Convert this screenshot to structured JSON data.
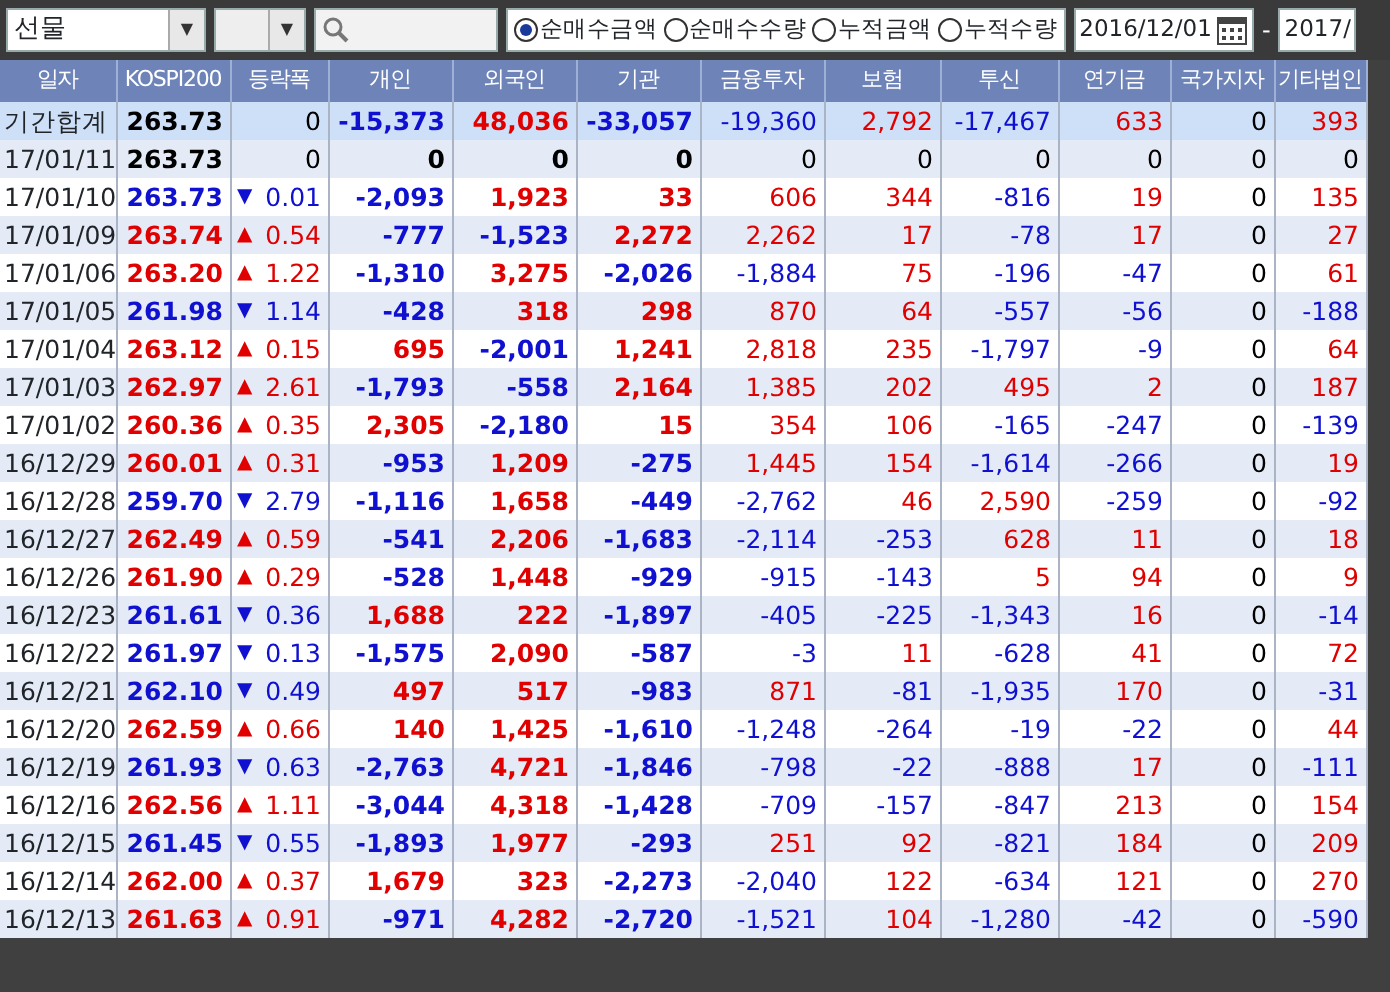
{
  "toolbar": {
    "market_select": {
      "value": "선물",
      "caret": "▼"
    },
    "sub_select": {
      "caret": "▼"
    },
    "view_options": [
      {
        "label": "순매수금액",
        "selected": true
      },
      {
        "label": "순매수수량",
        "selected": false
      },
      {
        "label": "누적금액",
        "selected": false
      },
      {
        "label": "누적수량",
        "selected": false
      }
    ],
    "start_date": "2016/12/01",
    "range_separator": "-",
    "end_date": "2017/"
  },
  "table": {
    "columns": [
      "일자",
      "KOSPI200",
      "등락폭",
      "개인",
      "외국인",
      "기관",
      "금융투자",
      "보험",
      "투신",
      "연기금",
      "국가지자",
      "기타법인"
    ],
    "rows": [
      {
        "kind": "total",
        "date": "기간합계",
        "kospi200": {
          "text": "263.73",
          "color": "#000000"
        },
        "change": {
          "text": "0",
          "color": "#000000"
        },
        "values": [
          {
            "text": "-15,373",
            "color": "#1010d0"
          },
          {
            "text": "48,036",
            "color": "#e00000"
          },
          {
            "text": "-33,057",
            "color": "#1010d0"
          },
          {
            "text": "-19,360",
            "color": "#1010d0"
          },
          {
            "text": "2,792",
            "color": "#e00000"
          },
          {
            "text": "-17,467",
            "color": "#1010d0"
          },
          {
            "text": "633",
            "color": "#e00000"
          },
          {
            "text": "0",
            "color": "#000000"
          },
          {
            "text": "393",
            "color": "#e00000"
          }
        ]
      },
      {
        "kind": "day",
        "date": "17/01/11",
        "kospi200": {
          "text": "263.73",
          "color": "#000000"
        },
        "change": {
          "text": "0",
          "color": "#000000"
        },
        "values": [
          {
            "text": "0",
            "color": "#000000"
          },
          {
            "text": "0",
            "color": "#000000"
          },
          {
            "text": "0",
            "color": "#000000"
          },
          {
            "text": "0",
            "color": "#000000"
          },
          {
            "text": "0",
            "color": "#000000"
          },
          {
            "text": "0",
            "color": "#000000"
          },
          {
            "text": "0",
            "color": "#000000"
          },
          {
            "text": "0",
            "color": "#000000"
          },
          {
            "text": "0",
            "color": "#000000"
          }
        ]
      },
      {
        "kind": "day",
        "date": "17/01/10",
        "kospi200": {
          "text": "263.73",
          "color": "#1010d0"
        },
        "change": {
          "arrow": "▼",
          "text": "0.01",
          "color": "#1010d0"
        },
        "values": [
          {
            "text": "-2,093",
            "color": "#1010d0"
          },
          {
            "text": "1,923",
            "color": "#e00000"
          },
          {
            "text": "33",
            "color": "#e00000"
          },
          {
            "text": "606",
            "color": "#e00000"
          },
          {
            "text": "344",
            "color": "#e00000"
          },
          {
            "text": "-816",
            "color": "#1010d0"
          },
          {
            "text": "19",
            "color": "#e00000"
          },
          {
            "text": "0",
            "color": "#000000"
          },
          {
            "text": "135",
            "color": "#e00000"
          }
        ]
      },
      {
        "kind": "day",
        "date": "17/01/09",
        "kospi200": {
          "text": "263.74",
          "color": "#e00000"
        },
        "change": {
          "arrow": "▲",
          "text": "0.54",
          "color": "#e00000"
        },
        "values": [
          {
            "text": "-777",
            "color": "#1010d0"
          },
          {
            "text": "-1,523",
            "color": "#1010d0"
          },
          {
            "text": "2,272",
            "color": "#e00000"
          },
          {
            "text": "2,262",
            "color": "#e00000"
          },
          {
            "text": "17",
            "color": "#e00000"
          },
          {
            "text": "-78",
            "color": "#1010d0"
          },
          {
            "text": "17",
            "color": "#e00000"
          },
          {
            "text": "0",
            "color": "#000000"
          },
          {
            "text": "27",
            "color": "#e00000"
          }
        ]
      },
      {
        "kind": "day",
        "date": "17/01/06",
        "kospi200": {
          "text": "263.20",
          "color": "#e00000"
        },
        "change": {
          "arrow": "▲",
          "text": "1.22",
          "color": "#e00000"
        },
        "values": [
          {
            "text": "-1,310",
            "color": "#1010d0"
          },
          {
            "text": "3,275",
            "color": "#e00000"
          },
          {
            "text": "-2,026",
            "color": "#1010d0"
          },
          {
            "text": "-1,884",
            "color": "#1010d0"
          },
          {
            "text": "75",
            "color": "#e00000"
          },
          {
            "text": "-196",
            "color": "#1010d0"
          },
          {
            "text": "-47",
            "color": "#1010d0"
          },
          {
            "text": "0",
            "color": "#000000"
          },
          {
            "text": "61",
            "color": "#e00000"
          }
        ]
      },
      {
        "kind": "day",
        "date": "17/01/05",
        "kospi200": {
          "text": "261.98",
          "color": "#1010d0"
        },
        "change": {
          "arrow": "▼",
          "text": "1.14",
          "color": "#1010d0"
        },
        "values": [
          {
            "text": "-428",
            "color": "#1010d0"
          },
          {
            "text": "318",
            "color": "#e00000"
          },
          {
            "text": "298",
            "color": "#e00000"
          },
          {
            "text": "870",
            "color": "#e00000"
          },
          {
            "text": "64",
            "color": "#e00000"
          },
          {
            "text": "-557",
            "color": "#1010d0"
          },
          {
            "text": "-56",
            "color": "#1010d0"
          },
          {
            "text": "0",
            "color": "#000000"
          },
          {
            "text": "-188",
            "color": "#1010d0"
          }
        ]
      },
      {
        "kind": "day",
        "date": "17/01/04",
        "kospi200": {
          "text": "263.12",
          "color": "#e00000"
        },
        "change": {
          "arrow": "▲",
          "text": "0.15",
          "color": "#e00000"
        },
        "values": [
          {
            "text": "695",
            "color": "#e00000"
          },
          {
            "text": "-2,001",
            "color": "#1010d0"
          },
          {
            "text": "1,241",
            "color": "#e00000"
          },
          {
            "text": "2,818",
            "color": "#e00000"
          },
          {
            "text": "235",
            "color": "#e00000"
          },
          {
            "text": "-1,797",
            "color": "#1010d0"
          },
          {
            "text": "-9",
            "color": "#1010d0"
          },
          {
            "text": "0",
            "color": "#000000"
          },
          {
            "text": "64",
            "color": "#e00000"
          }
        ]
      },
      {
        "kind": "day",
        "date": "17/01/03",
        "kospi200": {
          "text": "262.97",
          "color": "#e00000"
        },
        "change": {
          "arrow": "▲",
          "text": "2.61",
          "color": "#e00000"
        },
        "values": [
          {
            "text": "-1,793",
            "color": "#1010d0"
          },
          {
            "text": "-558",
            "color": "#1010d0"
          },
          {
            "text": "2,164",
            "color": "#e00000"
          },
          {
            "text": "1,385",
            "color": "#e00000"
          },
          {
            "text": "202",
            "color": "#e00000"
          },
          {
            "text": "495",
            "color": "#e00000"
          },
          {
            "text": "2",
            "color": "#e00000"
          },
          {
            "text": "0",
            "color": "#000000"
          },
          {
            "text": "187",
            "color": "#e00000"
          }
        ]
      },
      {
        "kind": "day",
        "date": "17/01/02",
        "kospi200": {
          "text": "260.36",
          "color": "#e00000"
        },
        "change": {
          "arrow": "▲",
          "text": "0.35",
          "color": "#e00000"
        },
        "values": [
          {
            "text": "2,305",
            "color": "#e00000"
          },
          {
            "text": "-2,180",
            "color": "#1010d0"
          },
          {
            "text": "15",
            "color": "#e00000"
          },
          {
            "text": "354",
            "color": "#e00000"
          },
          {
            "text": "106",
            "color": "#e00000"
          },
          {
            "text": "-165",
            "color": "#1010d0"
          },
          {
            "text": "-247",
            "color": "#1010d0"
          },
          {
            "text": "0",
            "color": "#000000"
          },
          {
            "text": "-139",
            "color": "#1010d0"
          }
        ]
      },
      {
        "kind": "day",
        "date": "16/12/29",
        "kospi200": {
          "text": "260.01",
          "color": "#e00000"
        },
        "change": {
          "arrow": "▲",
          "text": "0.31",
          "color": "#e00000"
        },
        "values": [
          {
            "text": "-953",
            "color": "#1010d0"
          },
          {
            "text": "1,209",
            "color": "#e00000"
          },
          {
            "text": "-275",
            "color": "#1010d0"
          },
          {
            "text": "1,445",
            "color": "#e00000"
          },
          {
            "text": "154",
            "color": "#e00000"
          },
          {
            "text": "-1,614",
            "color": "#1010d0"
          },
          {
            "text": "-266",
            "color": "#1010d0"
          },
          {
            "text": "0",
            "color": "#000000"
          },
          {
            "text": "19",
            "color": "#e00000"
          }
        ]
      },
      {
        "kind": "day",
        "date": "16/12/28",
        "kospi200": {
          "text": "259.70",
          "color": "#1010d0"
        },
        "change": {
          "arrow": "▼",
          "text": "2.79",
          "color": "#1010d0"
        },
        "values": [
          {
            "text": "-1,116",
            "color": "#1010d0"
          },
          {
            "text": "1,658",
            "color": "#e00000"
          },
          {
            "text": "-449",
            "color": "#1010d0"
          },
          {
            "text": "-2,762",
            "color": "#1010d0"
          },
          {
            "text": "46",
            "color": "#e00000"
          },
          {
            "text": "2,590",
            "color": "#e00000"
          },
          {
            "text": "-259",
            "color": "#1010d0"
          },
          {
            "text": "0",
            "color": "#000000"
          },
          {
            "text": "-92",
            "color": "#1010d0"
          }
        ]
      },
      {
        "kind": "day",
        "date": "16/12/27",
        "kospi200": {
          "text": "262.49",
          "color": "#e00000"
        },
        "change": {
          "arrow": "▲",
          "text": "0.59",
          "color": "#e00000"
        },
        "values": [
          {
            "text": "-541",
            "color": "#1010d0"
          },
          {
            "text": "2,206",
            "color": "#e00000"
          },
          {
            "text": "-1,683",
            "color": "#1010d0"
          },
          {
            "text": "-2,114",
            "color": "#1010d0"
          },
          {
            "text": "-253",
            "color": "#1010d0"
          },
          {
            "text": "628",
            "color": "#e00000"
          },
          {
            "text": "11",
            "color": "#e00000"
          },
          {
            "text": "0",
            "color": "#000000"
          },
          {
            "text": "18",
            "color": "#e00000"
          }
        ]
      },
      {
        "kind": "day",
        "date": "16/12/26",
        "kospi200": {
          "text": "261.90",
          "color": "#e00000"
        },
        "change": {
          "arrow": "▲",
          "text": "0.29",
          "color": "#e00000"
        },
        "values": [
          {
            "text": "-528",
            "color": "#1010d0"
          },
          {
            "text": "1,448",
            "color": "#e00000"
          },
          {
            "text": "-929",
            "color": "#1010d0"
          },
          {
            "text": "-915",
            "color": "#1010d0"
          },
          {
            "text": "-143",
            "color": "#1010d0"
          },
          {
            "text": "5",
            "color": "#e00000"
          },
          {
            "text": "94",
            "color": "#e00000"
          },
          {
            "text": "0",
            "color": "#000000"
          },
          {
            "text": "9",
            "color": "#e00000"
          }
        ]
      },
      {
        "kind": "day",
        "date": "16/12/23",
        "kospi200": {
          "text": "261.61",
          "color": "#1010d0"
        },
        "change": {
          "arrow": "▼",
          "text": "0.36",
          "color": "#1010d0"
        },
        "values": [
          {
            "text": "1,688",
            "color": "#e00000"
          },
          {
            "text": "222",
            "color": "#e00000"
          },
          {
            "text": "-1,897",
            "color": "#1010d0"
          },
          {
            "text": "-405",
            "color": "#1010d0"
          },
          {
            "text": "-225",
            "color": "#1010d0"
          },
          {
            "text": "-1,343",
            "color": "#1010d0"
          },
          {
            "text": "16",
            "color": "#e00000"
          },
          {
            "text": "0",
            "color": "#000000"
          },
          {
            "text": "-14",
            "color": "#1010d0"
          }
        ]
      },
      {
        "kind": "day",
        "date": "16/12/22",
        "kospi200": {
          "text": "261.97",
          "color": "#1010d0"
        },
        "change": {
          "arrow": "▼",
          "text": "0.13",
          "color": "#1010d0"
        },
        "values": [
          {
            "text": "-1,575",
            "color": "#1010d0"
          },
          {
            "text": "2,090",
            "color": "#e00000"
          },
          {
            "text": "-587",
            "color": "#1010d0"
          },
          {
            "text": "-3",
            "color": "#1010d0"
          },
          {
            "text": "11",
            "color": "#e00000"
          },
          {
            "text": "-628",
            "color": "#1010d0"
          },
          {
            "text": "41",
            "color": "#e00000"
          },
          {
            "text": "0",
            "color": "#000000"
          },
          {
            "text": "72",
            "color": "#e00000"
          }
        ]
      },
      {
        "kind": "day",
        "date": "16/12/21",
        "kospi200": {
          "text": "262.10",
          "color": "#1010d0"
        },
        "change": {
          "arrow": "▼",
          "text": "0.49",
          "color": "#1010d0"
        },
        "values": [
          {
            "text": "497",
            "color": "#e00000"
          },
          {
            "text": "517",
            "color": "#e00000"
          },
          {
            "text": "-983",
            "color": "#1010d0"
          },
          {
            "text": "871",
            "color": "#e00000"
          },
          {
            "text": "-81",
            "color": "#1010d0"
          },
          {
            "text": "-1,935",
            "color": "#1010d0"
          },
          {
            "text": "170",
            "color": "#e00000"
          },
          {
            "text": "0",
            "color": "#000000"
          },
          {
            "text": "-31",
            "color": "#1010d0"
          }
        ]
      },
      {
        "kind": "day",
        "date": "16/12/20",
        "kospi200": {
          "text": "262.59",
          "color": "#e00000"
        },
        "change": {
          "arrow": "▲",
          "text": "0.66",
          "color": "#e00000"
        },
        "values": [
          {
            "text": "140",
            "color": "#e00000"
          },
          {
            "text": "1,425",
            "color": "#e00000"
          },
          {
            "text": "-1,610",
            "color": "#1010d0"
          },
          {
            "text": "-1,248",
            "color": "#1010d0"
          },
          {
            "text": "-264",
            "color": "#1010d0"
          },
          {
            "text": "-19",
            "color": "#1010d0"
          },
          {
            "text": "-22",
            "color": "#1010d0"
          },
          {
            "text": "0",
            "color": "#000000"
          },
          {
            "text": "44",
            "color": "#e00000"
          }
        ]
      },
      {
        "kind": "day",
        "date": "16/12/19",
        "kospi200": {
          "text": "261.93",
          "color": "#1010d0"
        },
        "change": {
          "arrow": "▼",
          "text": "0.63",
          "color": "#1010d0"
        },
        "values": [
          {
            "text": "-2,763",
            "color": "#1010d0"
          },
          {
            "text": "4,721",
            "color": "#e00000"
          },
          {
            "text": "-1,846",
            "color": "#1010d0"
          },
          {
            "text": "-798",
            "color": "#1010d0"
          },
          {
            "text": "-22",
            "color": "#1010d0"
          },
          {
            "text": "-888",
            "color": "#1010d0"
          },
          {
            "text": "17",
            "color": "#e00000"
          },
          {
            "text": "0",
            "color": "#000000"
          },
          {
            "text": "-111",
            "color": "#1010d0"
          }
        ]
      },
      {
        "kind": "day",
        "date": "16/12/16",
        "kospi200": {
          "text": "262.56",
          "color": "#e00000"
        },
        "change": {
          "arrow": "▲",
          "text": "1.11",
          "color": "#e00000"
        },
        "values": [
          {
            "text": "-3,044",
            "color": "#1010d0"
          },
          {
            "text": "4,318",
            "color": "#e00000"
          },
          {
            "text": "-1,428",
            "color": "#1010d0"
          },
          {
            "text": "-709",
            "color": "#1010d0"
          },
          {
            "text": "-157",
            "color": "#1010d0"
          },
          {
            "text": "-847",
            "color": "#1010d0"
          },
          {
            "text": "213",
            "color": "#e00000"
          },
          {
            "text": "0",
            "color": "#000000"
          },
          {
            "text": "154",
            "color": "#e00000"
          }
        ]
      },
      {
        "kind": "day",
        "date": "16/12/15",
        "kospi200": {
          "text": "261.45",
          "color": "#1010d0"
        },
        "change": {
          "arrow": "▼",
          "text": "0.55",
          "color": "#1010d0"
        },
        "values": [
          {
            "text": "-1,893",
            "color": "#1010d0"
          },
          {
            "text": "1,977",
            "color": "#e00000"
          },
          {
            "text": "-293",
            "color": "#1010d0"
          },
          {
            "text": "251",
            "color": "#e00000"
          },
          {
            "text": "92",
            "color": "#e00000"
          },
          {
            "text": "-821",
            "color": "#1010d0"
          },
          {
            "text": "184",
            "color": "#e00000"
          },
          {
            "text": "0",
            "color": "#000000"
          },
          {
            "text": "209",
            "color": "#e00000"
          }
        ]
      },
      {
        "kind": "day",
        "date": "16/12/14",
        "kospi200": {
          "text": "262.00",
          "color": "#e00000"
        },
        "change": {
          "arrow": "▲",
          "text": "0.37",
          "color": "#e00000"
        },
        "values": [
          {
            "text": "1,679",
            "color": "#e00000"
          },
          {
            "text": "323",
            "color": "#e00000"
          },
          {
            "text": "-2,273",
            "color": "#1010d0"
          },
          {
            "text": "-2,040",
            "color": "#1010d0"
          },
          {
            "text": "122",
            "color": "#e00000"
          },
          {
            "text": "-634",
            "color": "#1010d0"
          },
          {
            "text": "121",
            "color": "#e00000"
          },
          {
            "text": "0",
            "color": "#000000"
          },
          {
            "text": "270",
            "color": "#e00000"
          }
        ]
      },
      {
        "kind": "day",
        "date": "16/12/13",
        "kospi200": {
          "text": "261.63",
          "color": "#e00000"
        },
        "change": {
          "arrow": "▲",
          "text": "0.91",
          "color": "#e00000"
        },
        "values": [
          {
            "text": "-971",
            "color": "#1010d0"
          },
          {
            "text": "4,282",
            "color": "#e00000"
          },
          {
            "text": "-2,720",
            "color": "#1010d0"
          },
          {
            "text": "-1,521",
            "color": "#1010d0"
          },
          {
            "text": "104",
            "color": "#e00000"
          },
          {
            "text": "-1,280",
            "color": "#1010d0"
          },
          {
            "text": "-42",
            "color": "#1010d0"
          },
          {
            "text": "0",
            "color": "#000000"
          },
          {
            "text": "-590",
            "color": "#1010d0"
          }
        ]
      }
    ]
  }
}
